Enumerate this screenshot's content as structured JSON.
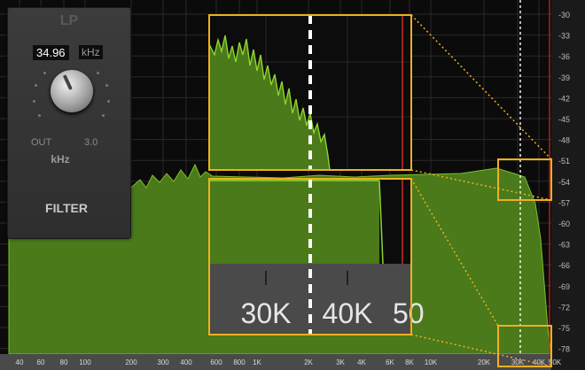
{
  "filter": {
    "mode": "LP",
    "frequency": "34.96",
    "frequency_unit": "kHz",
    "min_label": "OUT",
    "max_label": "3.0",
    "unit_label": "kHz",
    "title": "FILTER"
  },
  "spectrum": {
    "db_labels": [
      "-30",
      "-33",
      "-36",
      "-39",
      "-42",
      "-45",
      "-48",
      "-51",
      "-54",
      "-57",
      "-60",
      "-63",
      "-66",
      "-69",
      "-72",
      "-75",
      "-78"
    ],
    "freq_labels": [
      "40",
      "60",
      "80",
      "100",
      "200",
      "300",
      "400",
      "600",
      "800",
      "1K",
      "2K",
      "3K",
      "4K",
      "6K",
      "8K",
      "10K",
      "20K",
      "30K",
      "40K",
      "50K"
    ],
    "zoom_labels": [
      "30K",
      "40K",
      "50"
    ]
  },
  "colors": {
    "spectrum_fill": "#4a7a1a",
    "spectrum_line": "#8fd42e",
    "zoom_outline": "#f0b020",
    "cursor": "#ffffff",
    "red_marker": "#d02828"
  }
}
